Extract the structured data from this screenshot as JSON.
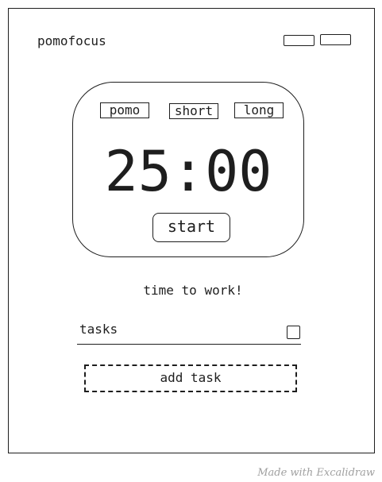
{
  "header": {
    "title": "pomofocus"
  },
  "timer": {
    "tabs": [
      {
        "label": "pomo"
      },
      {
        "label": "short"
      },
      {
        "label": "long"
      }
    ],
    "time": "25:00",
    "start_label": "start"
  },
  "status": "time to work!",
  "tasks": {
    "heading": "tasks",
    "add_label": "add task"
  },
  "watermark": "Made with Excalidraw"
}
